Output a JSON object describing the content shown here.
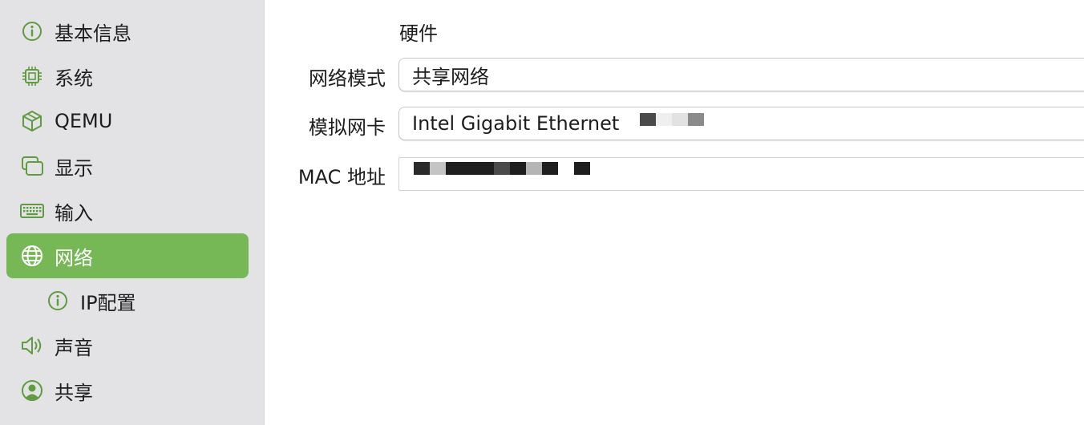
{
  "sidebar": {
    "items": [
      {
        "label": "基本信息",
        "icon": "info-circle-icon"
      },
      {
        "label": "系统",
        "icon": "cpu-chip-icon"
      },
      {
        "label": "QEMU",
        "icon": "cube-icon"
      },
      {
        "label": "显示",
        "icon": "display-windows-icon"
      },
      {
        "label": "输入",
        "icon": "keyboard-icon"
      },
      {
        "label": "网络",
        "icon": "globe-icon",
        "selected": true
      },
      {
        "label": "IP配置",
        "icon": "info-circle-icon",
        "sub": true
      },
      {
        "label": "声音",
        "icon": "speaker-icon"
      },
      {
        "label": "共享",
        "icon": "person-circle-icon"
      }
    ],
    "accent": "#77b856"
  },
  "main": {
    "section_title": "硬件",
    "network_mode": {
      "label": "网络模式",
      "value": "共享网络"
    },
    "emulated_nic": {
      "label": "模拟网卡",
      "value": "Intel Gigabit Ethernet"
    },
    "mac_address": {
      "label": "MAC 地址",
      "value": ""
    }
  }
}
